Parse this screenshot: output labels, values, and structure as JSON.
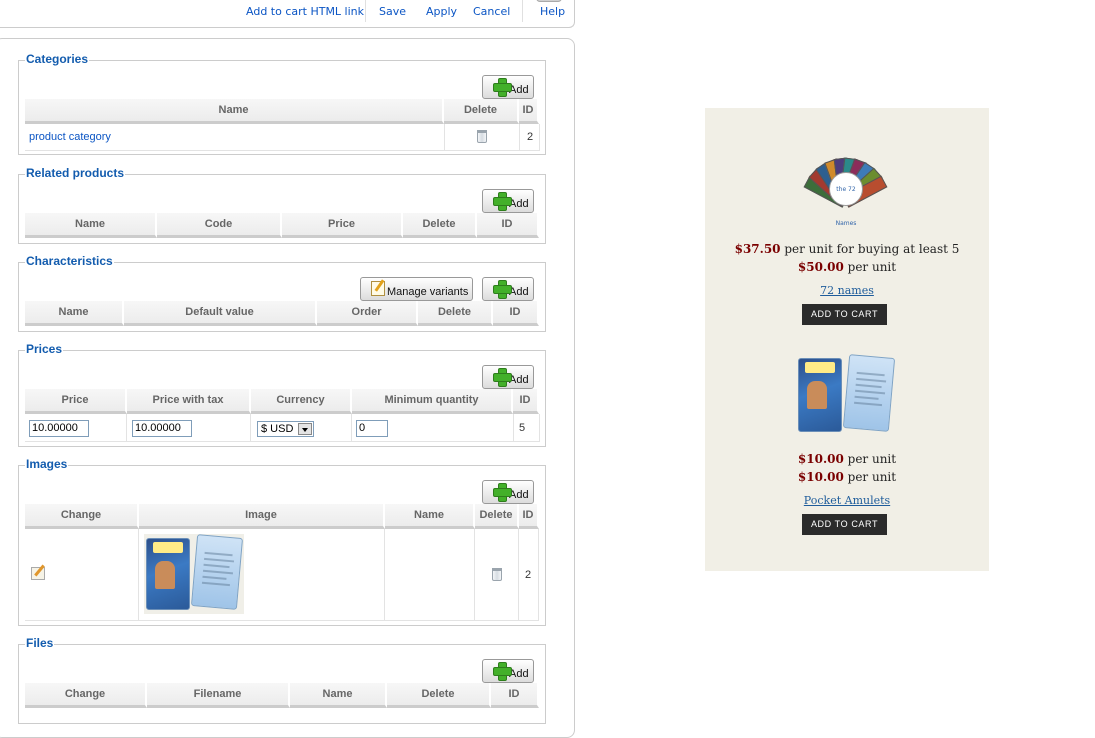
{
  "toolbar": {
    "add_to_cart_link": "Add to cart HTML link",
    "save": "Save",
    "apply": "Apply",
    "cancel": "Cancel",
    "help": "Help"
  },
  "categories": {
    "legend": "Categories",
    "add_label": "Add",
    "headers": [
      "Name",
      "Delete",
      "ID"
    ],
    "rows": [
      {
        "name": "product category",
        "id": "2"
      }
    ]
  },
  "related_products": {
    "legend": "Related products",
    "add_label": "Add",
    "headers": [
      "Name",
      "Code",
      "Price",
      "Delete",
      "ID"
    ]
  },
  "characteristics": {
    "legend": "Characteristics",
    "manage_variants_label": "Manage variants",
    "add_label": "Add",
    "headers": [
      "Name",
      "Default value",
      "Order",
      "Delete",
      "ID"
    ]
  },
  "prices": {
    "legend": "Prices",
    "add_label": "Add",
    "headers": [
      "Price",
      "Price with tax",
      "Currency",
      "Minimum quantity",
      "ID"
    ],
    "rows": [
      {
        "price": "10.00000",
        "price_with_tax": "10.00000",
        "currency": "$ USD",
        "min_qty": "0",
        "id": "5"
      }
    ]
  },
  "images": {
    "legend": "Images",
    "add_label": "Add",
    "headers": [
      "Change",
      "Image",
      "Name",
      "Delete",
      "ID"
    ],
    "rows": [
      {
        "name": "",
        "id": "2"
      }
    ]
  },
  "files": {
    "legend": "Files",
    "add_label": "Add",
    "headers": [
      "Change",
      "Filename",
      "Name",
      "Delete",
      "ID"
    ]
  },
  "preview": {
    "product1": {
      "seal_text": "the 72 Names",
      "tier_price": "$37.50",
      "tier_text": " per unit for buying at least 5",
      "unit_price": "$50.00",
      "unit_text": " per unit",
      "name": "72 names",
      "cart_label": "ADD TO CART"
    },
    "product2": {
      "tier_price": "$10.00",
      "tier_text": " per unit",
      "unit_price": "$10.00",
      "unit_text": " per unit",
      "name": "Pocket Amulets",
      "cart_label": "ADD TO CART"
    }
  },
  "colors": {
    "link": "#0b55c4",
    "legend": "#135cae",
    "price": "#7a0000",
    "preview_bg": "#f1efe6",
    "cart_button": "#2b2b2b"
  }
}
